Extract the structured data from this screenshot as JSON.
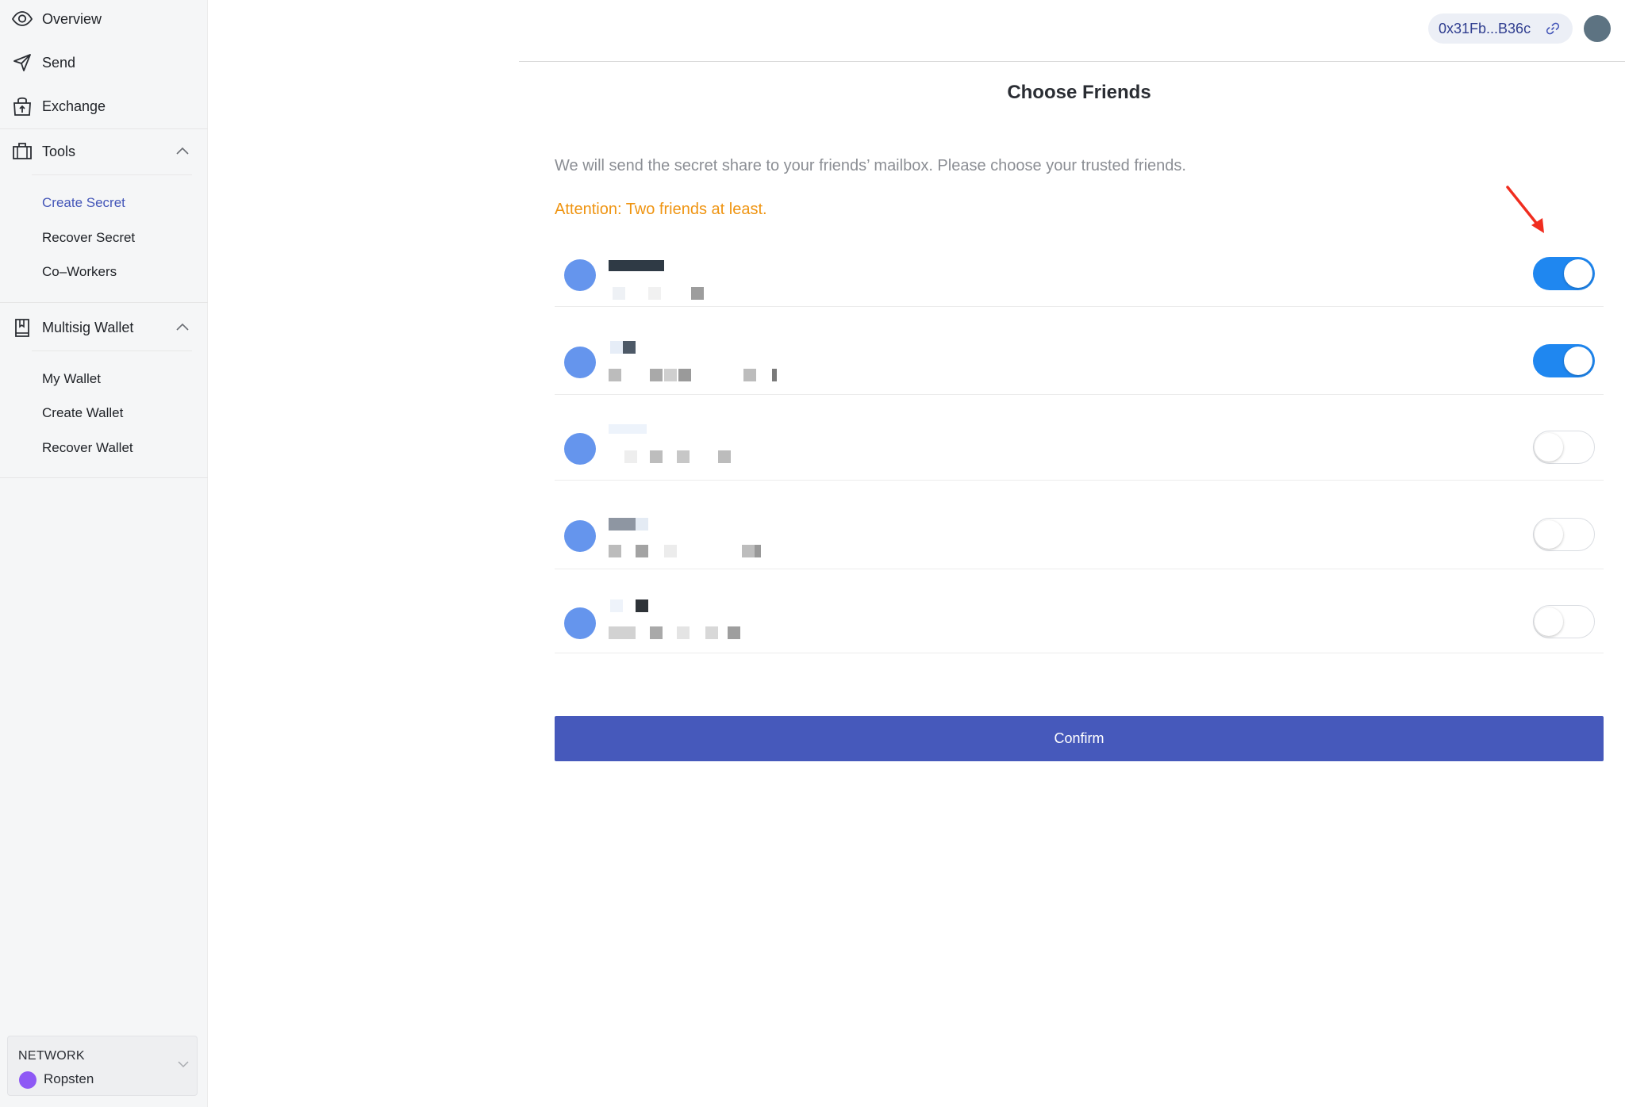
{
  "sidebar": {
    "nav": [
      {
        "label": "Overview",
        "icon": "eye-icon"
      },
      {
        "label": "Send",
        "icon": "send-icon"
      },
      {
        "label": "Exchange",
        "icon": "exchange-bag-icon"
      }
    ],
    "tools": {
      "label": "Tools",
      "icon": "toolbox-icon",
      "expanded": true,
      "items": [
        "Create Secret",
        "Recover Secret",
        "Co–Workers"
      ],
      "active": "Create Secret"
    },
    "multisig": {
      "label": "Multisig Wallet",
      "icon": "wallet-book-icon",
      "expanded": true,
      "items": [
        "My Wallet",
        "Create Wallet",
        "Recover Wallet"
      ]
    },
    "network": {
      "title": "NETWORK",
      "name": "Ropsten",
      "dot_color": "#8e59f5"
    }
  },
  "header": {
    "address": "0x31Fb...B36c",
    "avatar_color": "#5d7382"
  },
  "main": {
    "title": "Choose Friends",
    "description": "We will send the secret share to your friends’ mailbox. Please choose your trusted friends.",
    "attention": "Attention: Two friends at least.",
    "attention_color": "#ef9411",
    "friends": [
      {
        "name_hidden": true,
        "email_hidden": true,
        "selected": true
      },
      {
        "name_hidden": true,
        "email_hidden": true,
        "selected": true
      },
      {
        "name_hidden": true,
        "email_hidden": true,
        "selected": false
      },
      {
        "name_hidden": true,
        "email_hidden": true,
        "selected": false
      },
      {
        "name_hidden": true,
        "email_hidden": true,
        "selected": false
      }
    ],
    "confirm_label": "Confirm",
    "accent_color": "#4659bb",
    "toggle_on_color": "#1f87f0"
  }
}
